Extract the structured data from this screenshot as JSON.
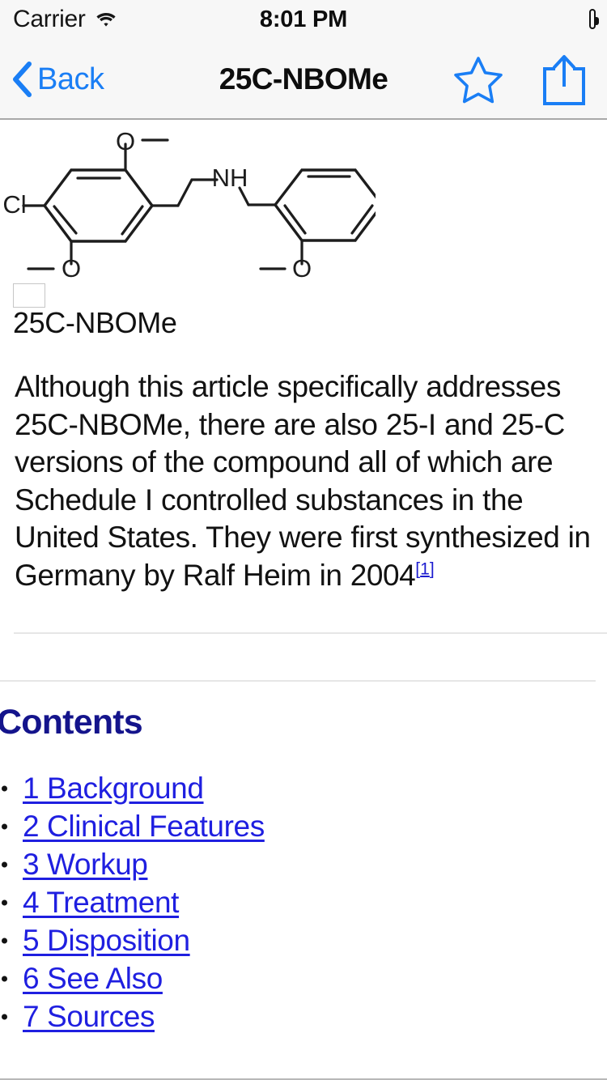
{
  "status_bar": {
    "carrier": "Carrier",
    "wifi_icon": "wifi-icon",
    "time": "8:01 PM",
    "battery_icon": "battery-full-icon"
  },
  "nav_bar": {
    "back_icon": "chevron-left-icon",
    "back_label": "Back",
    "title": "25C-NBOMe",
    "favorite_icon": "star-outline-icon",
    "share_icon": "share-export-icon"
  },
  "figure": {
    "caption": "25C-NBOMe",
    "placeholder_icon": "broken-image-placeholder",
    "structure": {
      "labels": [
        "O",
        "Cl",
        "O",
        "NH",
        "O"
      ],
      "description": "25C-NBOMe skeletal chemical structure"
    }
  },
  "article": {
    "lead_paragraph": "Although this article specifically addresses 25C-NBOMe, there are also 25-I and 25-C versions of the compound all of which are Schedule I controlled substances in the United States. They were first synthesized in Germany by Ralf Heim in 2004",
    "citation": {
      "open": "[",
      "number": "1",
      "close": "]"
    }
  },
  "contents": {
    "heading": "Contents",
    "items": [
      {
        "label": "1 Background"
      },
      {
        "label": "2 Clinical Features"
      },
      {
        "label": "3 Workup"
      },
      {
        "label": "4 Treatment"
      },
      {
        "label": "5 Disposition"
      },
      {
        "label": "6 See Also"
      },
      {
        "label": "7 Sources"
      }
    ]
  },
  "colors": {
    "accent_blue": "#1a7ef5",
    "link_blue": "#1f1fe0",
    "heading_navy": "#14148c",
    "bar_background": "#f7f7f7",
    "text": "#121212"
  }
}
